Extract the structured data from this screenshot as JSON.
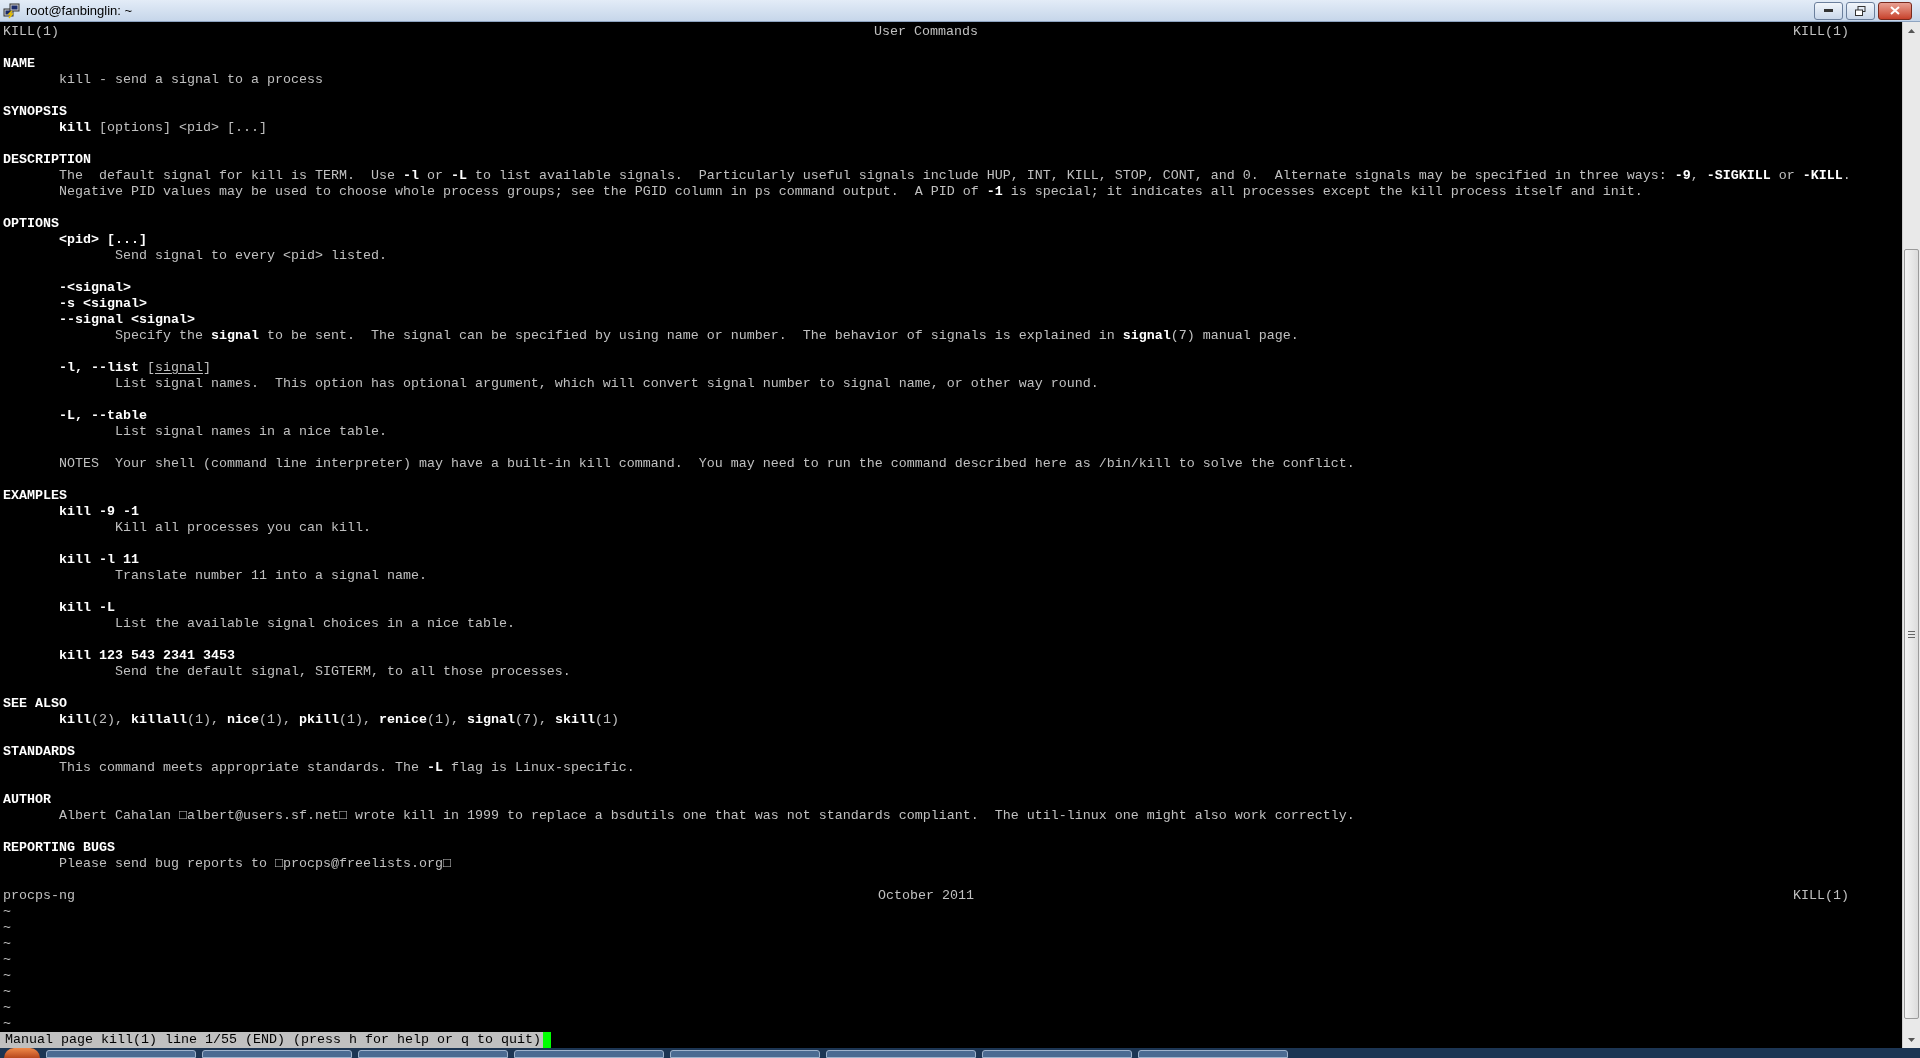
{
  "window": {
    "title": "root@fanbinglin: ~"
  },
  "man_header": {
    "left": "KILL(1)",
    "center": "User Commands",
    "right": "KILL(1)"
  },
  "sections": [
    {
      "heading": "NAME",
      "paragraphs": [
        {
          "lines": [
            {
              "text": "kill - send a signal to a process"
            }
          ]
        }
      ]
    },
    {
      "heading": "SYNOPSIS",
      "paragraphs": [
        {
          "lines": [
            {
              "text": "**kill** [options] <pid> [...]"
            }
          ]
        }
      ]
    },
    {
      "heading": "DESCRIPTION",
      "paragraphs": [
        {
          "lines": [
            {
              "text": "The  default signal for kill is TERM.  Use **-l** or **-L** to list available signals.  Particularly useful signals include HUP, INT, KILL, STOP, CONT, and 0.  Alternate signals may be specified in three ways: **-9**, **-SIGKILL** or **-KILL**."
            },
            {
              "text": "Negative PID values may be used to choose whole process groups; see the PGID column in ps command output.  A PID of **-1** is special; it indicates all processes except the kill process itself and init."
            }
          ]
        }
      ]
    },
    {
      "heading": "OPTIONS",
      "paragraphs": [
        {
          "lines": [
            {
              "text": "**<pid> [...]**"
            }
          ],
          "children": [
            {
              "text": "Send signal to every <pid> listed."
            }
          ]
        },
        {
          "lines": [
            {
              "text": "**-<signal>**"
            },
            {
              "text": "**-s <signal>**"
            },
            {
              "text": "**--signal <signal>**"
            }
          ],
          "children": [
            {
              "text": "Specify the **signal** to be sent.  The signal can be specified by using name or number.  The behavior of signals is explained in **signal**(7) manual page."
            }
          ]
        },
        {
          "lines": [
            {
              "kind": "option_with_argument",
              "text": "**-l, --list** [",
              "argument": "signal",
              "after": "]"
            }
          ],
          "children": [
            {
              "text": "List signal names.  This option has optional argument, which will convert signal number to signal name, or other way round."
            }
          ]
        },
        {
          "lines": [
            {
              "text": "**-L, --table**"
            }
          ],
          "children": [
            {
              "text": "List signal names in a nice table."
            }
          ]
        },
        {
          "lines": [
            {
              "text": "NOTES  Your shell (command line interpreter) may have a built-in kill command.  You may need to run the command described here as /bin/kill to solve the conflict."
            }
          ]
        }
      ]
    },
    {
      "heading": "EXAMPLES",
      "paragraphs": [
        {
          "lines": [
            {
              "text": "**kill -9 -1**"
            }
          ],
          "children": [
            {
              "text": "Kill all processes you can kill."
            }
          ]
        },
        {
          "lines": [
            {
              "text": "**kill -l 11**"
            }
          ],
          "children": [
            {
              "text": "Translate number 11 into a signal name."
            }
          ]
        },
        {
          "lines": [
            {
              "text": "**kill -L**"
            }
          ],
          "children": [
            {
              "text": "List the available signal choices in a nice table."
            }
          ]
        },
        {
          "lines": [
            {
              "text": "**kill 123 543 2341 3453**"
            }
          ],
          "children": [
            {
              "text": "Send the default signal, SIGTERM, to all those processes."
            }
          ]
        }
      ]
    },
    {
      "heading": "SEE ALSO",
      "paragraphs": [
        {
          "lines": [
            {
              "text": "**kill**(2), **killall**(1), **nice**(1), **pkill**(1), **renice**(1), **signal**(7), **skill**(1)"
            }
          ]
        }
      ]
    },
    {
      "heading": "STANDARDS",
      "paragraphs": [
        {
          "lines": [
            {
              "text": "This command meets appropriate standards. The **-L** flag is Linux-specific."
            }
          ]
        }
      ]
    },
    {
      "heading": "AUTHOR",
      "paragraphs": [
        {
          "lines": [
            {
              "text": "Albert Cahalan □albert@users.sf.net□ wrote kill in 1999 to replace a bsdutils one that was not standards compliant.  The util-linux one might also work correctly."
            }
          ]
        }
      ]
    },
    {
      "heading": "REPORTING BUGS",
      "paragraphs": [
        {
          "lines": [
            {
              "text": "Please send bug reports to □procps@freelists.org□"
            }
          ]
        }
      ]
    }
  ],
  "man_footer": {
    "left": "procps-ng",
    "center": "October 2011",
    "right": "KILL(1)"
  },
  "filler_lines": [
    "~",
    "~",
    "~",
    "~",
    "~",
    "~",
    "~",
    "~"
  ],
  "status_line": {
    "text": "Manual page kill(1) line 1/55 (END) (press h for help or q to quit)",
    "cursor": true
  }
}
